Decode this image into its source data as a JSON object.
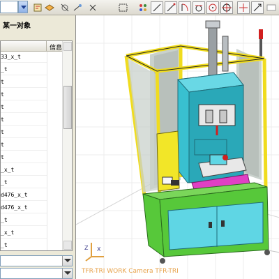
{
  "toolbar": {
    "tools": [
      "view-combo",
      "select-icon",
      "layer-icon",
      "hide-icon",
      "fit-icon",
      "select-box-icon",
      "snap-point-icon",
      "line-icon",
      "snap-endpoint-icon",
      "arc-icon",
      "tangent-icon",
      "circle-icon",
      "cross-point-icon",
      "snap-exist-icon"
    ]
  },
  "panel": {
    "title": "某一对象",
    "list": {
      "column_name": "",
      "column_info": "信息",
      "items": [
        "33_x_t",
        "_t",
        "t",
        "t",
        "t",
        "t",
        "t",
        "t",
        "t",
        "_x_t",
        "_t",
        "d476_x_t",
        "d476_x_t",
        "_t",
        "_x_t",
        "_t"
      ]
    },
    "dropdowns": [
      "",
      ""
    ]
  },
  "viewport": {
    "camera_label": "TFR-TRI WORK Camera TFR-TRI",
    "axes": {
      "z_label": "Z",
      "x_label": "X"
    },
    "colors": {
      "background": "#ffffff",
      "grid": "#ececec",
      "frame": "#f0dc1e",
      "base": "#57c83a",
      "cabinet": "#5fd6e4",
      "press_body": "#39c0d0",
      "fixture": "#e03fc4",
      "panel_box": "#f2e628",
      "mesh": "#9aa6a0",
      "light_tower": "#d11f1f"
    }
  }
}
